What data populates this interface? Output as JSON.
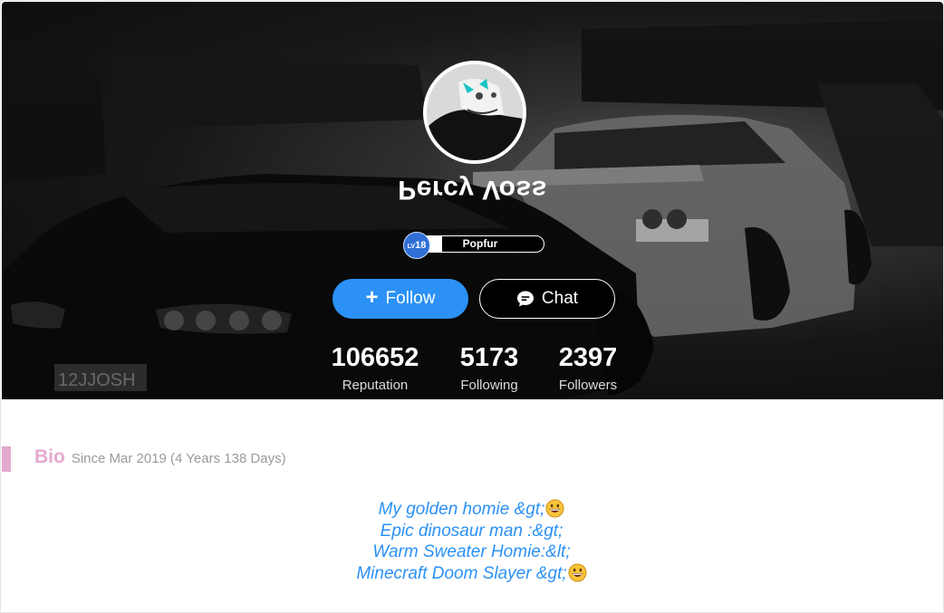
{
  "profile": {
    "username": "Percy Voss",
    "level": {
      "badge_prefix": "LV",
      "number": "18",
      "title": "Popfur",
      "progress": 0.2
    },
    "follow_label": "Follow",
    "chat_label": "Chat",
    "stats": [
      {
        "value": "106652",
        "label": "Reputation"
      },
      {
        "value": "5173",
        "label": "Following"
      },
      {
        "value": "2397",
        "label": "Followers"
      }
    ]
  },
  "bio": {
    "title": "Bio",
    "since": "Since Mar 2019 (4 Years 138 Days)",
    "lines": [
      {
        "text": "My golden homie &gt;",
        "emoji": "grinning-face"
      },
      {
        "text": "Epic dinosaur man :&gt;",
        "emoji": ""
      },
      {
        "text": "Warm Sweater Homie:&lt;",
        "emoji": ""
      },
      {
        "text": "Minecraft Doom Slayer &gt;",
        "emoji": "grinning-face"
      }
    ]
  },
  "colors": {
    "accent": "#2b91f5",
    "bio_pink": "#e4a9cf",
    "cover_dark": "#1c1c1c"
  },
  "icons": [
    "plus-icon",
    "chat-bubble-icon",
    "level-badge-icon",
    "grinning-face-emoji"
  ]
}
